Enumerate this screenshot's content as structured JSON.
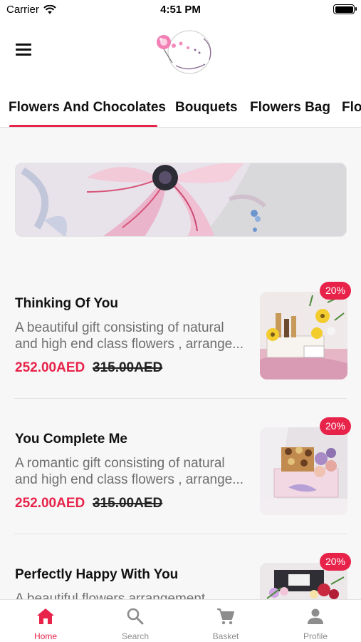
{
  "status_bar": {
    "carrier": "Carrier",
    "time": "4:51 PM"
  },
  "header": {
    "logo_icon": "pink-mimosa-logo"
  },
  "tabs": [
    {
      "label": "Flowers And Chocolates",
      "active": true
    },
    {
      "label": "Bouquets",
      "active": false
    },
    {
      "label": "Flowers Bag",
      "active": false
    },
    {
      "label": "Flo",
      "active": false
    }
  ],
  "products": [
    {
      "title": "Thinking Of You",
      "desc_line1": "A beautiful gift consisting of natural",
      "desc_line2": "and high end class flowers , arrange...",
      "price": "252.00AED",
      "old_price": "315.00AED",
      "discount": "20%"
    },
    {
      "title": "You Complete Me",
      "desc_line1": "A romantic gift consisting of natural",
      "desc_line2": "and high end class flowers , arrange...",
      "price": "252.00AED",
      "old_price": "315.00AED",
      "discount": "20%"
    },
    {
      "title": "Perfectly Happy With You",
      "desc_line1": "A beautiful flowers arrangement",
      "discount": "20%"
    }
  ],
  "bottom_nav": [
    {
      "label": "Home",
      "icon": "home-icon",
      "active": true
    },
    {
      "label": "Search",
      "icon": "search-icon",
      "active": false
    },
    {
      "label": "Basket",
      "icon": "cart-icon",
      "active": false
    },
    {
      "label": "Profile",
      "icon": "profile-icon",
      "active": false
    }
  ],
  "colors": {
    "accent": "#e8234a",
    "background": "#f7f7f7"
  }
}
